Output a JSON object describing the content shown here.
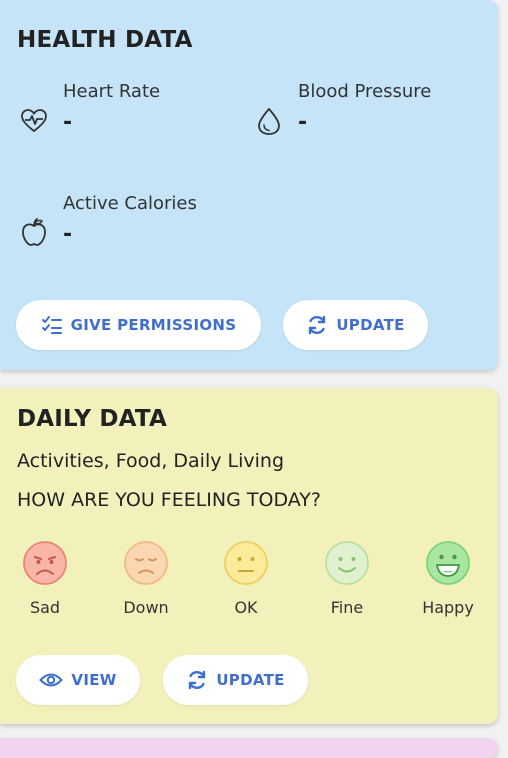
{
  "health": {
    "title": "HEALTH DATA",
    "heart_rate": {
      "label": "Heart Rate",
      "value": "-",
      "icon": "heart-pulse-icon"
    },
    "blood_pressure": {
      "label": "Blood Pressure",
      "value": "-",
      "icon": "droplet-icon"
    },
    "active_calories": {
      "label": "Active Calories",
      "value": "-",
      "icon": "apple-icon"
    },
    "give_permissions_label": "GIVE PERMISSIONS",
    "update_label": "UPDATE"
  },
  "daily": {
    "title": "DAILY DATA",
    "subtitle": "Activities, Food, Daily Living",
    "question": "HOW ARE YOU FEELING TODAY?",
    "moods": [
      {
        "label": "Sad",
        "color": "#f9b5a8",
        "stroke": "#e88676"
      },
      {
        "label": "Down",
        "color": "#fad7b0",
        "stroke": "#f0b986"
      },
      {
        "label": "OK",
        "color": "#faec9a",
        "stroke": "#eed060"
      },
      {
        "label": "Fine",
        "color": "#dff1cf",
        "stroke": "#b9e0a1"
      },
      {
        "label": "Happy",
        "color": "#a9e6a1",
        "stroke": "#7fd276"
      }
    ],
    "view_label": "VIEW",
    "update_label": "UPDATE"
  },
  "colors": {
    "health_bg": "#c5e4f7",
    "daily_bg": "#f3f1bb",
    "accent": "#3f6ecf"
  }
}
